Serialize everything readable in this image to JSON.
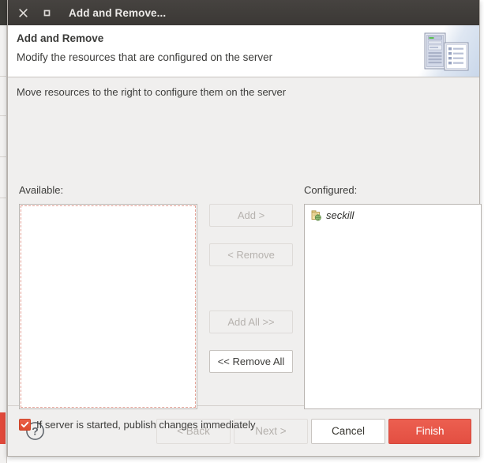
{
  "window": {
    "title": "Add and Remove...",
    "close_icon": "close-icon",
    "maximize_icon": "maximize-icon"
  },
  "header": {
    "title": "Add and Remove",
    "subtitle": "Modify the resources that are configured on the server",
    "icon": "server-and-document-icon"
  },
  "main": {
    "instruction": "Move resources to the right to configure them on the server",
    "available_label": "Available:",
    "configured_label": "Configured:",
    "available_items": [],
    "configured_items": [
      {
        "label": "seckill",
        "icon": "web-module-icon"
      }
    ],
    "transfer_buttons": [
      {
        "label": "Add >",
        "name": "add-button",
        "enabled": false
      },
      {
        "label": "< Remove",
        "name": "remove-button",
        "enabled": false
      },
      {
        "label": "Add All >>",
        "name": "add-all-button",
        "enabled": false
      },
      {
        "label": "<< Remove All",
        "name": "remove-all-button",
        "enabled": true
      }
    ],
    "publish_checkbox": {
      "label": "If server is started, publish changes immediately",
      "checked": true
    }
  },
  "footer": {
    "help_icon": "help-icon",
    "buttons": [
      {
        "label": "< Back",
        "name": "back-button",
        "style": "disabled"
      },
      {
        "label": "Next >",
        "name": "next-button",
        "style": "disabled"
      },
      {
        "label": "Cancel",
        "name": "cancel-button",
        "style": "normal"
      },
      {
        "label": "Finish",
        "name": "finish-button",
        "style": "primary"
      }
    ]
  },
  "colors": {
    "titlebar": "#413e3b",
    "dialog_bg": "#f0efee",
    "primary_accent": "#e9574a",
    "checkbox_accent": "#e2593f",
    "focus_ring": "#e2a095",
    "text": "#3d3d3b",
    "disabled_text": "#b4b0ac"
  }
}
